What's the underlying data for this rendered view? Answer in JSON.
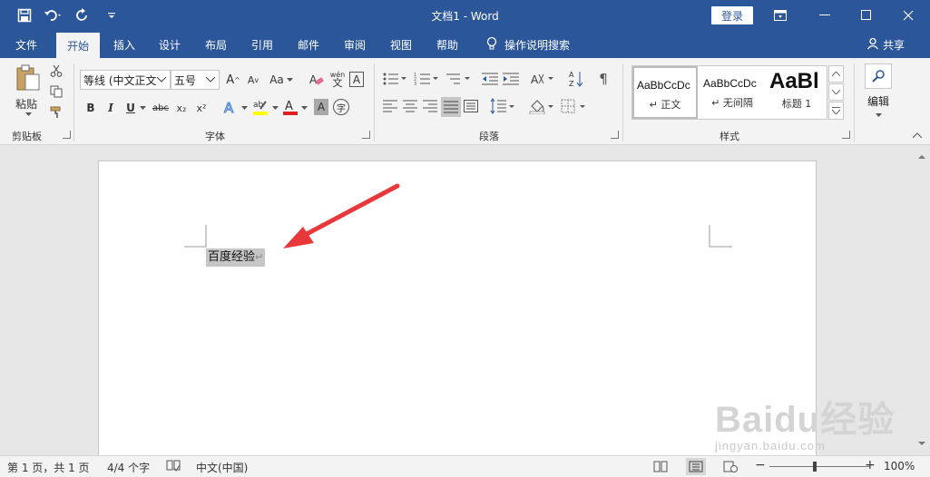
{
  "window": {
    "title": "文档1 - Word",
    "sign_in": "登录",
    "title_bg": "#2b579a"
  },
  "qat": {
    "icons": [
      "save-icon",
      "undo-icon",
      "redo-icon",
      "customize-icon"
    ]
  },
  "tabs": [
    {
      "label": "文件"
    },
    {
      "label": "开始"
    },
    {
      "label": "插入"
    },
    {
      "label": "设计"
    },
    {
      "label": "布局"
    },
    {
      "label": "引用"
    },
    {
      "label": "邮件"
    },
    {
      "label": "审阅"
    },
    {
      "label": "视图"
    },
    {
      "label": "帮助"
    }
  ],
  "active_tab": "开始",
  "tell_me": "操作说明搜索",
  "share": "共享",
  "ribbon": {
    "clipboard": {
      "paste": "粘贴",
      "label": "剪贴板"
    },
    "font": {
      "font_name": "等线 (中文正文",
      "font_size": "五号",
      "label": "字体",
      "bold": "B",
      "italic": "I",
      "underline": "U",
      "strike": "abc",
      "sub": "x₂",
      "sup": "x²",
      "change_case": "Aa",
      "phonetic": "wén",
      "phonetic_char": "文",
      "border_char": "A",
      "shade_char": "A",
      "enclose_char": "字"
    },
    "paragraph": {
      "label": "段落"
    },
    "styles": {
      "label": "样式",
      "items": [
        {
          "preview": "AaBbCcDc",
          "name": "正文"
        },
        {
          "preview": "AaBbCcDc",
          "name": "无间隔"
        },
        {
          "preview": "AaBl",
          "name": "标题 1"
        }
      ]
    },
    "editing": {
      "label": "编辑"
    }
  },
  "document": {
    "text": "百度经验",
    "pilcrow": "↵"
  },
  "annotation_color": "#e8383a",
  "watermark": {
    "main": "Baidu经验",
    "sub": "jingyan.baidu.com"
  },
  "status": {
    "page": "第 1 页，共 1 页",
    "words": "4/4 个字",
    "language": "中文(中国)",
    "zoom": "100%"
  }
}
